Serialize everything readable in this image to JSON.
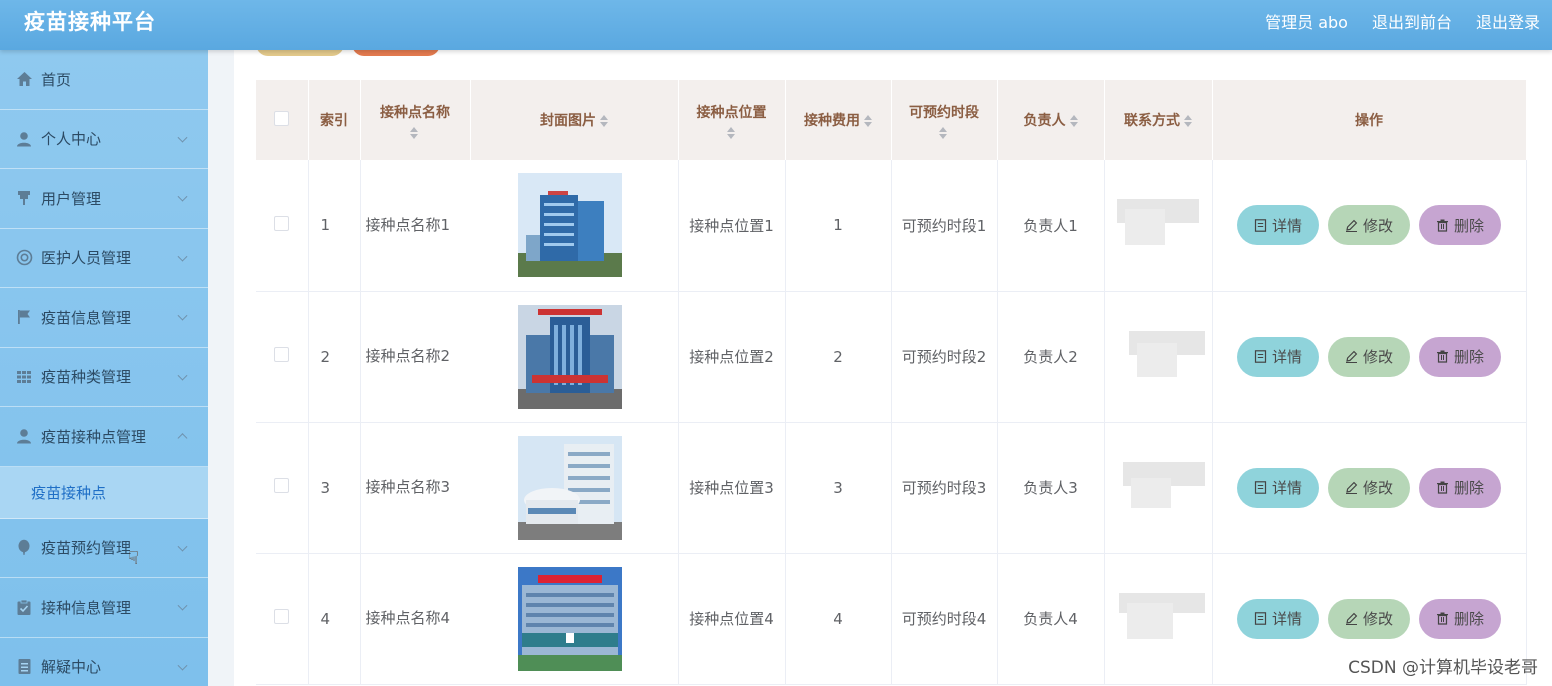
{
  "header": {
    "title": "疫苗接种平台",
    "admin_label": "管理员 abo",
    "back_front": "退出到前台",
    "logout": "退出登录"
  },
  "sidebar": {
    "items": [
      {
        "label": "首页",
        "icon": "home-icon"
      },
      {
        "label": "个人中心",
        "icon": "user-icon"
      },
      {
        "label": "用户管理",
        "icon": "pin-icon"
      },
      {
        "label": "医护人员管理",
        "icon": "lifebuoy-icon"
      },
      {
        "label": "疫苗信息管理",
        "icon": "flag-icon"
      },
      {
        "label": "疫苗种类管理",
        "icon": "grid-icon"
      },
      {
        "label": "疫苗接种点管理",
        "icon": "user-icon"
      },
      {
        "label": "疫苗预约管理",
        "icon": "balloon-icon"
      },
      {
        "label": "接种信息管理",
        "icon": "clipboard-check-icon"
      },
      {
        "label": "解疑中心",
        "icon": "document-icon"
      }
    ],
    "submenu": {
      "label": "疫苗接种点"
    }
  },
  "table": {
    "headers": {
      "index": "索引",
      "name": "接种点名称",
      "cover": "封面图片",
      "location": "接种点位置",
      "fee": "接种费用",
      "slot": "可预约时段",
      "manager": "负责人",
      "contact": "联系方式",
      "actions": "操作"
    },
    "rows": [
      {
        "index": "1",
        "name": "接种点名称1",
        "location": "接种点位置1",
        "fee": "1",
        "slot": "可预约时段1",
        "manager": "负责人1"
      },
      {
        "index": "2",
        "name": "接种点名称2",
        "location": "接种点位置2",
        "fee": "2",
        "slot": "可预约时段2",
        "manager": "负责人2"
      },
      {
        "index": "3",
        "name": "接种点名称3",
        "location": "接种点位置3",
        "fee": "3",
        "slot": "可预约时段3",
        "manager": "负责人3"
      },
      {
        "index": "4",
        "name": "接种点名称4",
        "location": "接种点位置4",
        "fee": "4",
        "slot": "可预约时段4",
        "manager": "负责人4"
      }
    ],
    "actions": {
      "detail": "详情",
      "edit": "修改",
      "delete": "删除"
    }
  },
  "colors": {
    "header_bg": "#62ade3",
    "sidebar_bg": "#86c4ed",
    "submenu_text": "#1f6fc6",
    "btn_detail": "#8fd3db",
    "btn_edit": "#b6d6b7",
    "btn_delete": "#c6a5d1",
    "th_text": "#8b5e43"
  },
  "watermark": "CSDN @计算机毕设老哥"
}
